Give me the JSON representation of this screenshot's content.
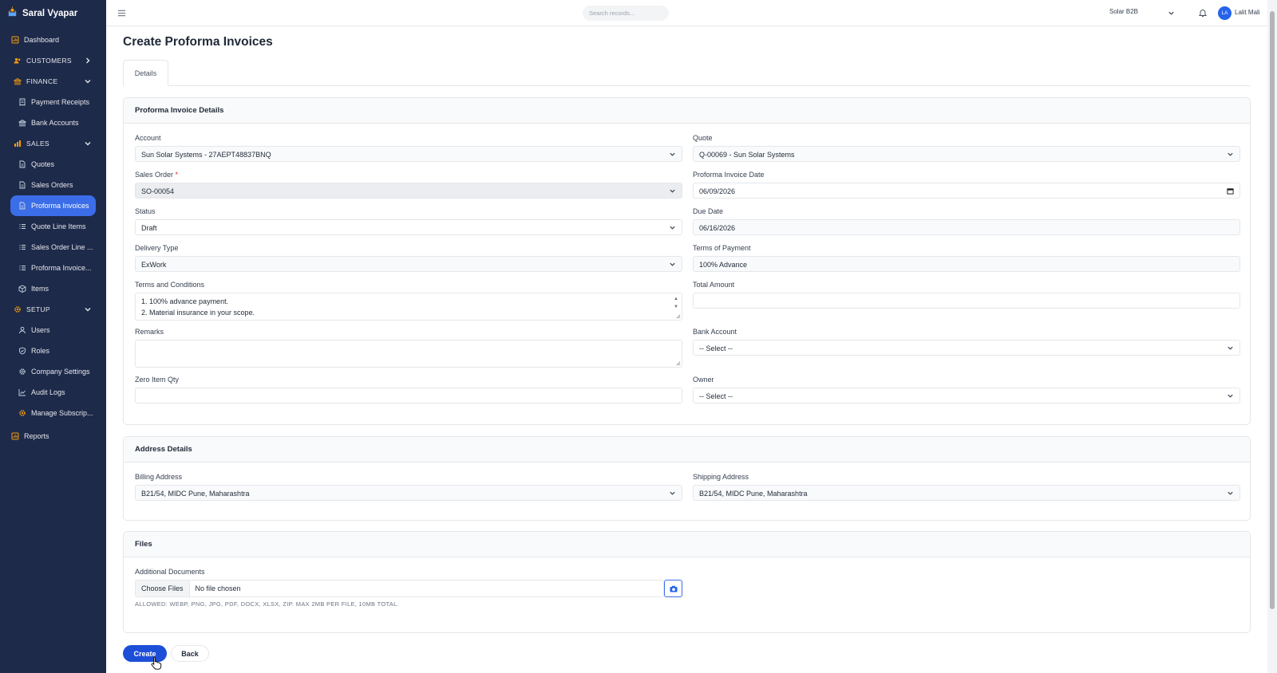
{
  "brand": {
    "name": "Saral Vyapar"
  },
  "sidebar": {
    "items": [
      {
        "label": "Dashboard"
      },
      {
        "label": "CUSTOMERS"
      },
      {
        "label": "FINANCE"
      },
      {
        "label": "Payment Receipts"
      },
      {
        "label": "Bank Accounts"
      },
      {
        "label": "SALES"
      },
      {
        "label": "Quotes"
      },
      {
        "label": "Sales Orders"
      },
      {
        "label": "Proforma Invoices"
      },
      {
        "label": "Quote Line Items"
      },
      {
        "label": "Sales Order Line ..."
      },
      {
        "label": "Proforma Invoice..."
      },
      {
        "label": "Items"
      },
      {
        "label": "SETUP"
      },
      {
        "label": "Users"
      },
      {
        "label": "Roles"
      },
      {
        "label": "Company Settings"
      },
      {
        "label": "Audit Logs"
      },
      {
        "label": "Manage Subscrip..."
      },
      {
        "label": "Reports"
      }
    ]
  },
  "topbar": {
    "search_placeholder": "Search records...",
    "org": "Solar B2B",
    "avatar_initials": "LA",
    "user_name": "Lalit Mali"
  },
  "page": {
    "title": "Create Proforma Invoices",
    "tab": "Details"
  },
  "details": {
    "heading": "Proforma Invoice Details",
    "account": {
      "label": "Account",
      "value": "Sun Solar Systems - 27AEPT48837BNQ"
    },
    "quote": {
      "label": "Quote",
      "value": "Q-00069 - Sun Solar Systems"
    },
    "sales_order": {
      "label": "Sales Order",
      "required": "*",
      "value": "SO-00054"
    },
    "pi_date": {
      "label": "Proforma Invoice Date",
      "value": "06/09/2026"
    },
    "status": {
      "label": "Status",
      "value": "Draft"
    },
    "due_date": {
      "label": "Due Date",
      "value": "06/16/2026"
    },
    "delivery_type": {
      "label": "Delivery Type",
      "value": "ExWork"
    },
    "terms_of_payment": {
      "label": "Terms of Payment",
      "value": "100% Advance"
    },
    "terms": {
      "label": "Terms and Conditions",
      "line1": "1. 100% advance payment.",
      "line2": "2. Material insurance in your scope."
    },
    "total_amount": {
      "label": "Total Amount",
      "value": ""
    },
    "remarks": {
      "label": "Remarks",
      "value": ""
    },
    "bank_account": {
      "label": "Bank Account",
      "value": "-- Select --"
    },
    "zero_item_qty": {
      "label": "Zero Item Qty",
      "value": ""
    },
    "owner": {
      "label": "Owner",
      "value": "-- Select --"
    }
  },
  "address": {
    "heading": "Address Details",
    "billing": {
      "label": "Billing Address",
      "value": "B21/54, MIDC Pune, Maharashtra"
    },
    "shipping": {
      "label": "Shipping Address",
      "value": "B21/54, MIDC Pune, Maharashtra"
    }
  },
  "files": {
    "heading": "Files",
    "label": "Additional Documents",
    "choose": "Choose Files",
    "none": "No file chosen",
    "hint": "ALLOWED: WEBP, PNG, JPG, PDF, DOCX, XLSX, ZIP. MAX 2MB PER FILE, 10MB TOTAL."
  },
  "actions": {
    "create": "Create",
    "back": "Back"
  },
  "colors": {
    "sidebar": "#1e2a4a",
    "accent": "#3b6de8",
    "primary_button": "#1d4ed8",
    "setup_icon": "#f59e0b"
  }
}
